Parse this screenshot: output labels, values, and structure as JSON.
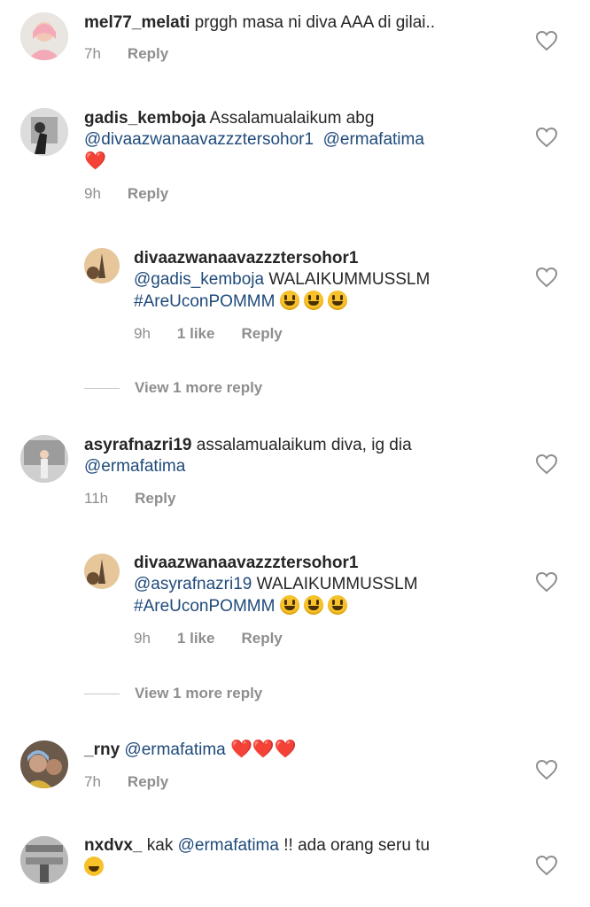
{
  "colors": {
    "username": "#262626",
    "mention": "#1f4a7a",
    "meta": "#8e8e8e",
    "heart": "#e0245e"
  },
  "comments": [
    {
      "username": "mel77_melati",
      "text": "prggh masa ni diva AAA di gilai..",
      "time": "7h",
      "reply_label": "Reply"
    },
    {
      "username": "gadis_kemboja",
      "text": "Assalamualaikum abg",
      "mention1": "@divaazwanaavazzztersohor1",
      "mention2": "@ermafatima",
      "emoji": "❤️",
      "time": "9h",
      "reply_label": "Reply",
      "reply": {
        "username": "divaazwanaavazzztersohor1",
        "mention": "@gadis_kemboja",
        "text": "WALAIKUMMUSSLM",
        "hashtag": "#AreUconPOMMM",
        "emojis": "😃😃😃",
        "time": "9h",
        "likes": "1 like",
        "reply_label": "Reply"
      },
      "view_more": "View 1 more reply"
    },
    {
      "username": "asyrafnazri19",
      "text": "assalamualaikum diva, ig dia",
      "mention1": "@ermafatima",
      "time": "11h",
      "reply_label": "Reply",
      "reply": {
        "username": "divaazwanaavazzztersohor1",
        "mention": "@asyrafnazri19",
        "text": "WALAIKUMMUSSLM",
        "hashtag": "#AreUconPOMMM",
        "emojis": "😃😃😃",
        "time": "9h",
        "likes": "1 like",
        "reply_label": "Reply"
      },
      "view_more": "View 1 more reply"
    },
    {
      "username": "_rny",
      "mention1": "@ermafatima",
      "emoji": "❤️❤️❤️",
      "time": "7h",
      "reply_label": "Reply"
    },
    {
      "username": "nxdvx_",
      "text1": "kak",
      "mention1": "@ermafatima",
      "text2": "!! ada orang seru tu",
      "emoji": "😂"
    }
  ]
}
